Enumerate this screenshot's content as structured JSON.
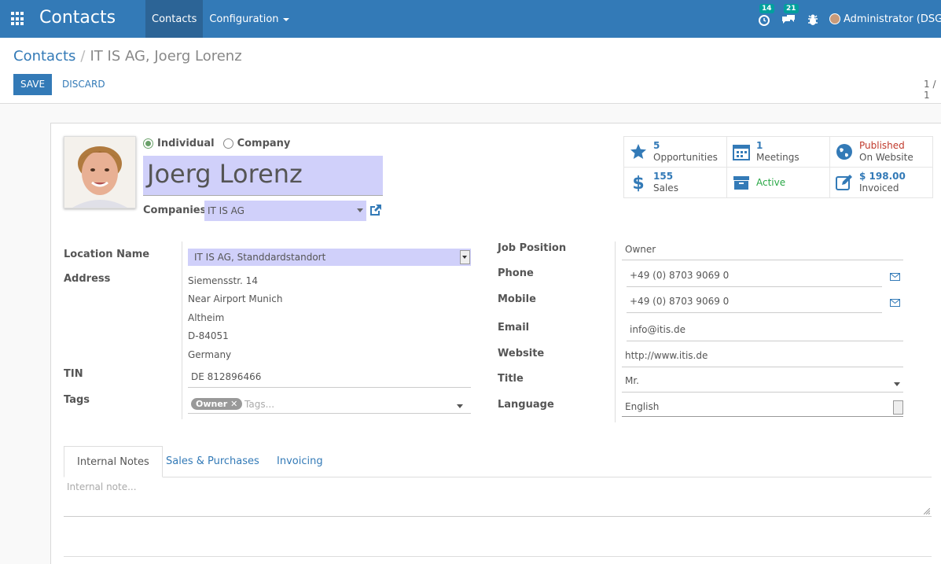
{
  "navbar": {
    "app_title": "Contacts",
    "menu": [
      {
        "label": "Contacts",
        "active": true
      },
      {
        "label": "Configuration",
        "active": false
      }
    ],
    "activity_count": "14",
    "message_count": "21",
    "user_name": "Administrator (DSGV("
  },
  "breadcrumb": {
    "parent": "Contacts",
    "separator": "/",
    "current": "IT IS AG, Joerg Lorenz"
  },
  "actions": {
    "save": "SAVE",
    "discard": "DISCARD",
    "pager": "1 / 1"
  },
  "contact": {
    "type_options": [
      "Individual",
      "Company"
    ],
    "type_selected": "Individual",
    "name": "Joerg Lorenz",
    "companies_label": "Companies",
    "company": "IT IS AG"
  },
  "stats": [
    {
      "value": "5",
      "label": "Opportunities",
      "icon": "star-icon"
    },
    {
      "value": "1",
      "label": "Meetings",
      "icon": "calendar-icon"
    },
    {
      "value": "Published",
      "label": "On Website",
      "icon": "globe-icon"
    },
    {
      "value": "155",
      "label": "Sales",
      "icon": "dollar-icon"
    },
    {
      "value": "Active",
      "label": "",
      "icon": "archive-icon"
    },
    {
      "value": "$ 198.00",
      "label": "Invoiced",
      "icon": "pencil-square-icon"
    }
  ],
  "left_fields": {
    "location_label": "Location Name",
    "location_value": "IT IS AG, Standdardstandort",
    "address_label": "Address",
    "address_lines": [
      "Siemensstr. 14",
      "Near Airport Munich",
      "Altheim",
      "D-84051",
      "Germany"
    ],
    "tin_label": "TIN",
    "tin_value": "DE 812896466",
    "tags_label": "Tags",
    "tag": "Owner",
    "tags_placeholder": "Tags..."
  },
  "right_fields": {
    "job_label": "Job Position",
    "job_value": "Owner",
    "phone_label": "Phone",
    "phone_value": "+49 (0) 8703 9069 0",
    "mobile_label": "Mobile",
    "mobile_value": "+49 (0) 8703 9069 0",
    "email_label": "Email",
    "email_value": "info@itis.de",
    "website_label": "Website",
    "website_value": "http://www.itis.de",
    "title_label": "Title",
    "title_value": "Mr.",
    "language_label": "Language",
    "language_value": "English"
  },
  "notebook": {
    "tabs": [
      "Internal Notes",
      "Sales & Purchases",
      "Invoicing"
    ],
    "active_tab": "Internal Notes",
    "notes_placeholder": "Internal note..."
  },
  "colors": {
    "brand": "#337ab7",
    "required_field": "#d0d0fa",
    "published": "#c0392b",
    "active": "#28a745"
  }
}
